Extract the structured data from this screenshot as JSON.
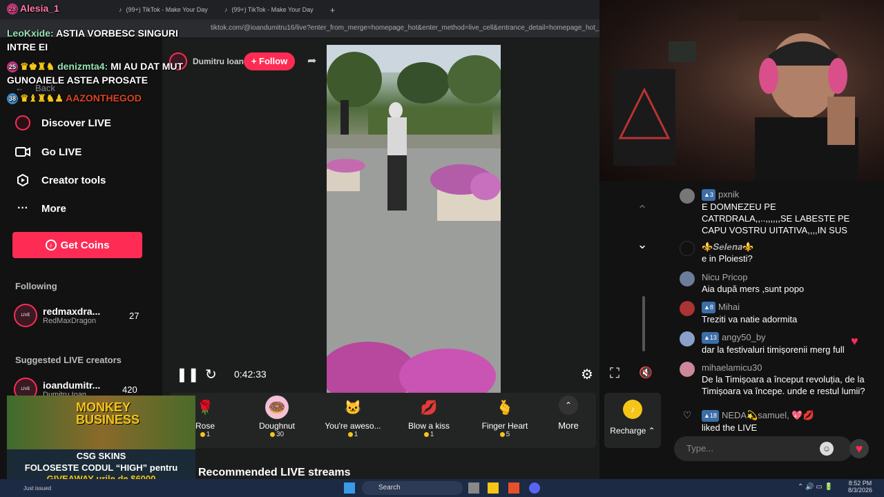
{
  "browser": {
    "tabs": [
      "(99+) TikTok - Make Your Day",
      "(99+) TikTok - Make Your Day"
    ],
    "new_tab": "+",
    "url": "tiktok.com/@ioandumitru16/live?enter_from_merge=homepage_hot&enter_method=live_cell&entrance_detail=homepage_hot_live_cell&"
  },
  "overlay_chat": [
    {
      "level": "28",
      "user": "Alesia_1",
      "text": ""
    },
    {
      "level": "",
      "user": "LeoKxide:",
      "text": "ASTIA VORBESC SINGURI INTRE EI"
    },
    {
      "level": "25",
      "user": "denizmta4:",
      "text": "MI AU DAT MUT GUNOAIELE ASTEA PROSATE"
    },
    {
      "level": "38",
      "user": "AAZONTHEGOD",
      "text": ""
    }
  ],
  "sidebar": {
    "back_label": "Back",
    "items": [
      {
        "label": "Discover LIVE",
        "icon": "live-icon"
      },
      {
        "label": "Go LIVE",
        "icon": "video-camera-icon"
      },
      {
        "label": "Creator tools",
        "icon": "tools-icon"
      },
      {
        "label": "More",
        "icon": "more-dots-icon"
      }
    ],
    "get_coins": "Get Coins",
    "following_heading": "Following",
    "following": [
      {
        "name": "redmaxdra...",
        "sub": "RedMaxDragon",
        "count": "27",
        "badge": "LIVE"
      }
    ],
    "suggested_heading": "Suggested LIVE creators",
    "suggested": [
      {
        "name": "ioandumitr...",
        "sub": "Dumitru Ioan",
        "count": "420",
        "badge": "LIVE"
      }
    ]
  },
  "stream": {
    "host_name": "Dumitru Ioan",
    "follow_label": "+ Follow",
    "elapsed": "0:42:33",
    "recommended_heading": "Recommended LIVE streams"
  },
  "gifts": [
    {
      "name": "Rose",
      "price": "1",
      "icon": "rose-icon"
    },
    {
      "name": "Doughnut",
      "price": "30",
      "icon": "doughnut-icon"
    },
    {
      "name": "You're aweso...",
      "price": "1",
      "icon": "cat-icon"
    },
    {
      "name": "Blow a kiss",
      "price": "1",
      "icon": "lips-icon"
    },
    {
      "name": "Finger Heart",
      "price": "5",
      "icon": "finger-heart-icon"
    }
  ],
  "gift_more": "More",
  "recharge": "Recharge",
  "chat": [
    {
      "level": "3",
      "user": "pxnik",
      "text": "E DOMNEZEU PE CATRDRALA,,..,,,,,,SE LABESTE PE CAPU VOSTRU UITATIVA,,,,IN SUS",
      "avatar": "#777"
    },
    {
      "level": "",
      "user": "⚜️𝑺𝒆𝒍𝒆𝒏𝒂⚜️",
      "text": "e in Ploiesti?",
      "avatar": "#111"
    },
    {
      "level": "",
      "user": "Nicu Pricop",
      "text": "Aia după mers ,sunt popo",
      "avatar": "#6b7d9a"
    },
    {
      "level": "8",
      "user": "Mihai",
      "text": "Treziti va natie adormita",
      "avatar": "#a33"
    },
    {
      "level": "13",
      "user": "angy50_by",
      "text": "dar la festivaluri timișorenii merg full",
      "avatar": "#8aa0c8"
    },
    {
      "level": "",
      "user": "mihaelamicu30",
      "text": "De la Timișoara a început revoluția, de la Timișoara va începe. unde e restul lumii?",
      "avatar": "#c89"
    },
    {
      "level": "18",
      "user": "NEDA💫samuel, 💖💋",
      "text": "liked the LIVE",
      "avatar": "heart"
    }
  ],
  "chat_placeholder": "Type...",
  "ad": {
    "title": "MONKEY BUSINESS",
    "brand": "CSG SKINS",
    "line1": "FOLOSESTE CODUL “HIGH” pentru",
    "line2": "GIVEAWAY-urile de $6000",
    "status": "Just issued"
  },
  "taskbar": {
    "search": "Search",
    "time": "8:52 PM",
    "date": "8/3/2026"
  },
  "colors": {
    "accent": "#fe2c55",
    "coin": "#f5c518",
    "badge": "#3c6ea8"
  }
}
